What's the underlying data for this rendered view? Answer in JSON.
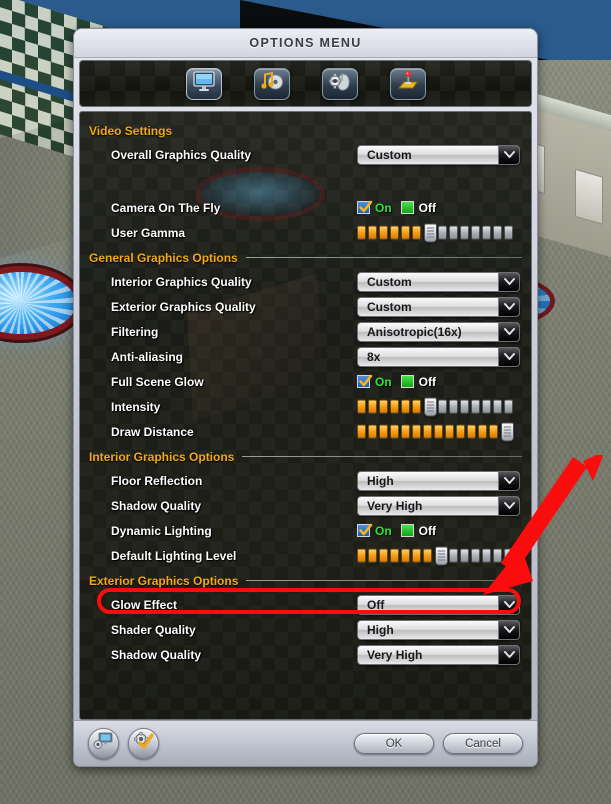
{
  "window": {
    "title": "OPTIONS MENU"
  },
  "tabs": [
    {
      "icon": "monitor-icon",
      "name": "video",
      "active": true
    },
    {
      "icon": "music-note-cd-icon",
      "name": "audio",
      "active": false
    },
    {
      "icon": "gear-mouse-icon",
      "name": "controls",
      "active": false
    },
    {
      "icon": "joystick-icon",
      "name": "gamepad",
      "active": false
    }
  ],
  "sections": [
    {
      "id": "video-settings",
      "label": "Video Settings",
      "rule": false,
      "rows": [
        {
          "id": "overall-graphics-quality",
          "label": "Overall Graphics Quality",
          "type": "dropdown",
          "value": "Custom"
        },
        {
          "id": "row-spacer",
          "type": "spacer"
        },
        {
          "id": "camera-on-the-fly",
          "label": "Camera On The Fly",
          "type": "toggle",
          "on_label": "On",
          "off_label": "Off",
          "value": "On"
        },
        {
          "id": "user-gamma",
          "label": "User Gamma",
          "type": "slider",
          "filled": 6,
          "empty": 7,
          "handle_at_end": false
        }
      ]
    },
    {
      "id": "general-graphics-options",
      "label": "General Graphics Options",
      "rule": true,
      "rows": [
        {
          "id": "interior-graphics-quality",
          "label": "Interior Graphics Quality",
          "type": "dropdown",
          "value": "Custom"
        },
        {
          "id": "exterior-graphics-quality",
          "label": "Exterior Graphics Quality",
          "type": "dropdown",
          "value": "Custom"
        },
        {
          "id": "filtering",
          "label": "Filtering",
          "type": "dropdown",
          "value": "Anisotropic(16x)"
        },
        {
          "id": "anti-aliasing",
          "label": "Anti-aliasing",
          "type": "dropdown",
          "value": "8x"
        },
        {
          "id": "full-scene-glow",
          "label": "Full Scene Glow",
          "type": "toggle",
          "on_label": "On",
          "off_label": "Off",
          "value": "On"
        },
        {
          "id": "intensity",
          "label": "Intensity",
          "type": "slider",
          "filled": 6,
          "empty": 7,
          "handle_at_end": false
        },
        {
          "id": "draw-distance",
          "label": "Draw Distance",
          "type": "slider",
          "filled": 13,
          "empty": 0,
          "handle_at_end": true
        }
      ]
    },
    {
      "id": "interior-graphics-options",
      "label": "Interior Graphics Options",
      "rule": true,
      "rows": [
        {
          "id": "floor-reflection",
          "label": "Floor Reflection",
          "type": "dropdown",
          "value": "High"
        },
        {
          "id": "shadow-quality-interior",
          "label": "Shadow Quality",
          "type": "dropdown",
          "value": "Very High"
        },
        {
          "id": "dynamic-lighting",
          "label": "Dynamic Lighting",
          "type": "toggle",
          "on_label": "On",
          "off_label": "Off",
          "value": "On"
        },
        {
          "id": "default-lighting-level",
          "label": "Default Lighting Level",
          "type": "slider",
          "filled": 7,
          "empty": 6,
          "handle_at_end": false
        }
      ]
    },
    {
      "id": "exterior-graphics-options",
      "label": "Exterior Graphics Options",
      "rule": true,
      "rows": [
        {
          "id": "glow-effect",
          "label": "Glow Effect",
          "type": "dropdown",
          "value": "Off",
          "highlighted": true
        },
        {
          "id": "shader-quality",
          "label": "Shader Quality",
          "type": "dropdown",
          "value": "High"
        },
        {
          "id": "shadow-quality-exterior",
          "label": "Shadow Quality",
          "type": "dropdown",
          "value": "Very High"
        }
      ]
    }
  ],
  "footer": {
    "icon_buttons": [
      {
        "icon": "monitor-gear-icon",
        "name": "display-settings-button"
      },
      {
        "icon": "gear-check-icon",
        "name": "apply-defaults-button"
      }
    ],
    "ok_label": "OK",
    "cancel_label": "Cancel"
  },
  "annotation": {
    "highlight_color": "#fb0d0d",
    "target": "glow-effect",
    "shape": "ellipse-and-arrow"
  },
  "colors": {
    "section_header": "#f2a818",
    "row_label": "#ffffff",
    "on_text": "#2ee23a",
    "slider_filled": "#f59b12",
    "annotation": "#fb0d0d"
  }
}
